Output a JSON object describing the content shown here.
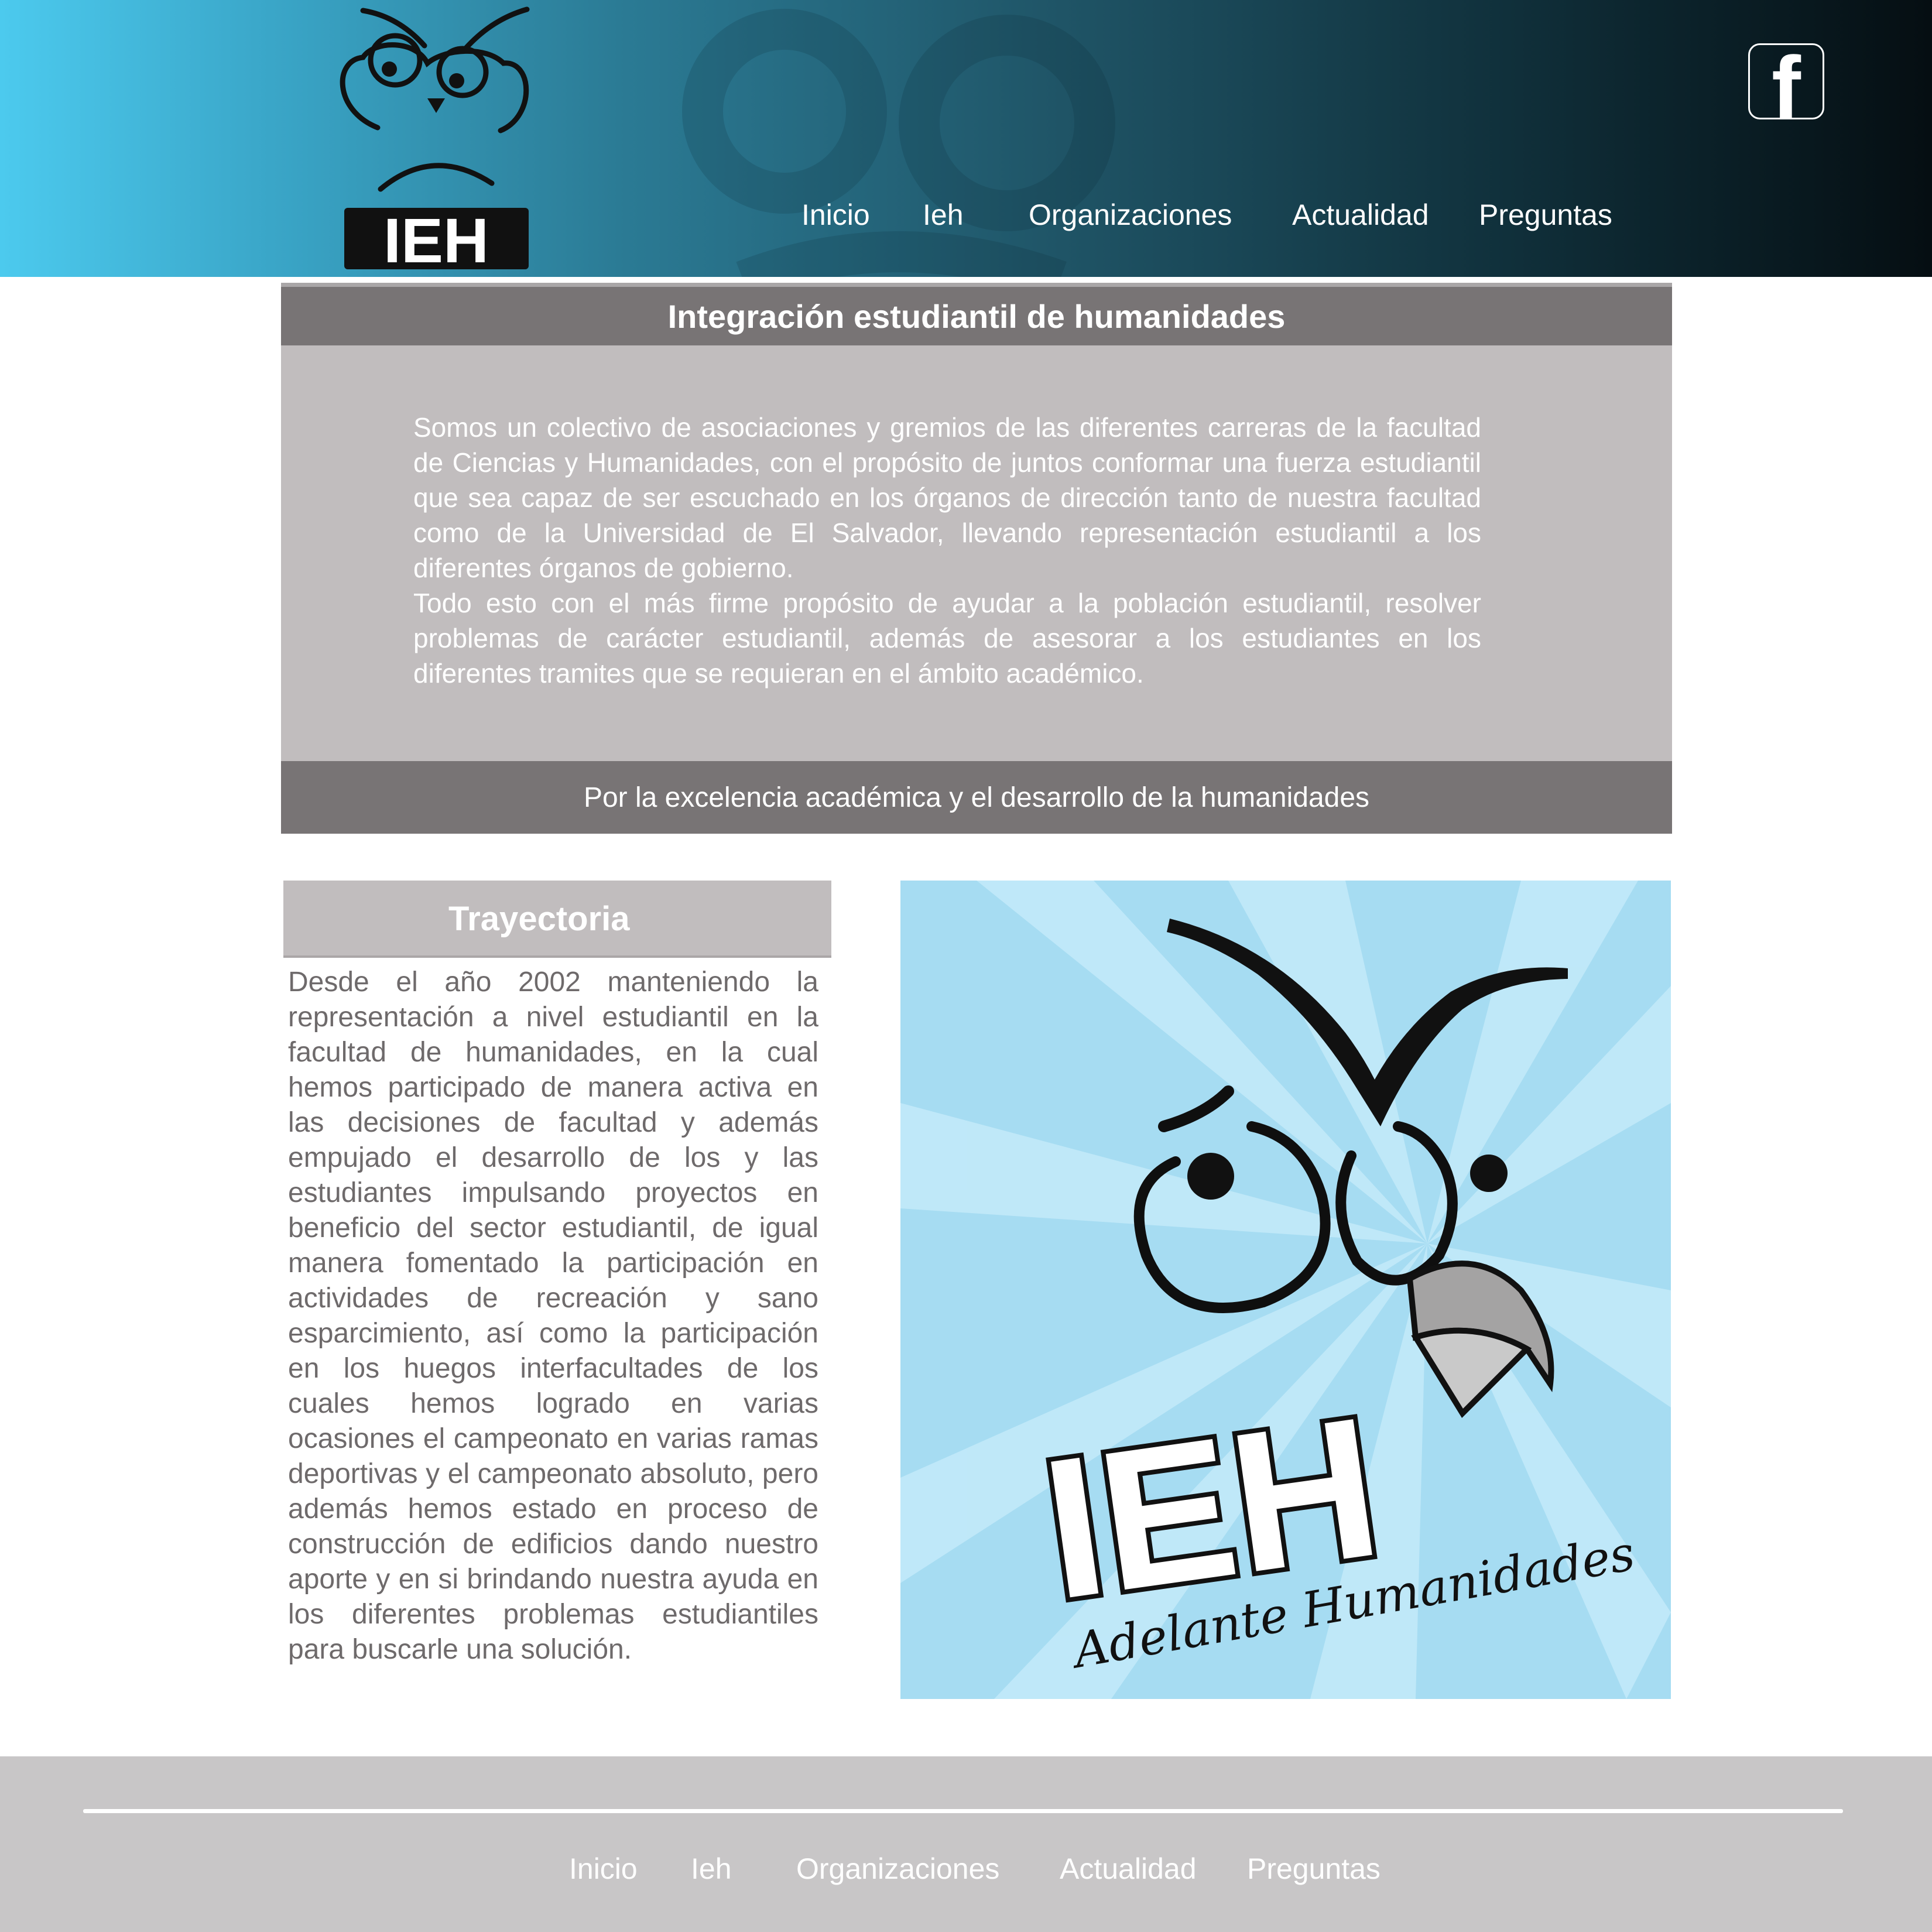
{
  "header": {
    "logo_text": "IEH",
    "nav": [
      {
        "label": "Inicio"
      },
      {
        "label": "Ieh"
      },
      {
        "label": "Organizaciones"
      },
      {
        "label": "Actualidad"
      },
      {
        "label": "Preguntas"
      }
    ],
    "social_icon": "facebook-icon",
    "social_glyph": "f"
  },
  "intro": {
    "title": "Integración estudiantil de humanidades",
    "paragraphs": [
      "Somos un colectivo de asociaciones y gremios de las diferentes carreras de la facultad de Ciencias y Humanidades, con el propósito de juntos conformar una fuerza estudiantil que sea capaz de ser escuchado en los órganos de dirección tanto de nuestra facultad como de la Universidad de El Salvador, llevando representación estudiantil a los diferentes órganos de gobierno.",
      "Todo esto con el más firme propósito de ayudar a la población estudiantil, resolver problemas de carácter estudiantil, además de asesorar a los estudiantes en los diferentes tramites que se requieran en el ámbito académico."
    ],
    "motto": "Por la excelencia académica y el desarrollo de la humanidades"
  },
  "trayectoria": {
    "title": "Trayectoria",
    "text": "Desde el año 2002 manteniendo la representación a nivel estudiantil en la facultad de humanidades, en la cual hemos participado de manera activa en las decisiones de facultad y además empujado el desarrollo de los y las estudiantes impulsando proyectos en beneficio del sector estudiantil, de igual manera fomentado la participación en actividades de recreación y sano esparcimiento, así como la participación en los huegos interfacultades de los cuales hemos logrado en varias ocasiones el campeonato en varias ramas deportivas y el campeonato absoluto, pero además hemos estado en proceso de construcción de edificios dando nuestro aporte y en si brindando nuestra ayuda en los diferentes problemas estudiantiles para buscarle una solución."
  },
  "image": {
    "logo_text": "IEH",
    "slogan": "Adelante Humanidades"
  },
  "footer": {
    "nav": [
      {
        "label": "Inicio"
      },
      {
        "label": "Ieh"
      },
      {
        "label": "Organizaciones"
      },
      {
        "label": "Actualidad"
      },
      {
        "label": "Preguntas"
      }
    ]
  },
  "colors": {
    "header_gradient_start": "#4ccaee",
    "header_gradient_end": "#050e12",
    "panel_dark": "#787475",
    "panel_light": "#c1bdbe",
    "footer_bg": "#c8c6c7",
    "body_text": "#6e6a6b",
    "image_sky": "#a6dcf2"
  }
}
